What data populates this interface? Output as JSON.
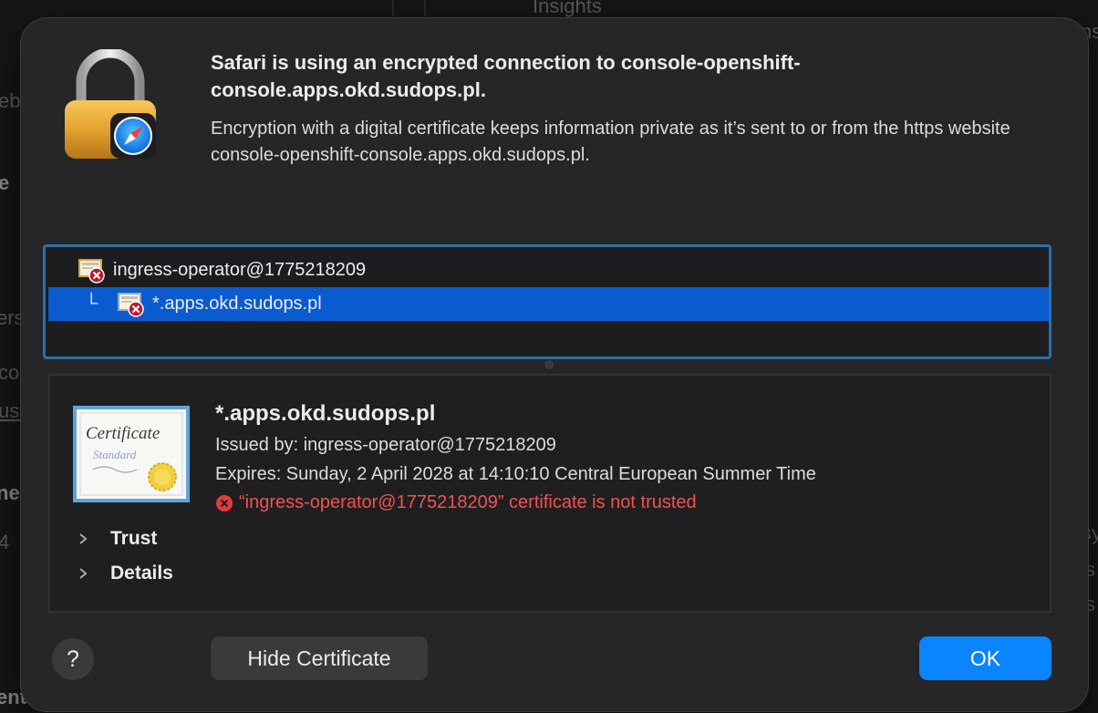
{
  "background": {
    "fragments": [
      "Insights",
      "eb",
      "e",
      "ers",
      "co",
      "ust",
      "ne",
      "4",
      "ins",
      "sy",
      "s",
      "s",
      "entory"
    ]
  },
  "dialog": {
    "heading": "Safari is using an encrypted connection to console-openshift-console.apps.okd.sudops.pl.",
    "description": "Encryption with a digital certificate keeps information private as it’s sent to or from the https website console-openshift-console.apps.okd.sudops.pl."
  },
  "certificate_tree": {
    "items": [
      {
        "label": "ingress-operator@1775218209",
        "level": 0,
        "selected": false,
        "status": "untrusted"
      },
      {
        "label": "*.apps.okd.sudops.pl",
        "level": 1,
        "selected": true,
        "status": "untrusted"
      }
    ]
  },
  "certificate_detail": {
    "name": "*.apps.okd.sudops.pl",
    "issued_by": "Issued by: ingress-operator@1775218209",
    "expires": "Expires: Sunday, 2 April 2028 at 14:10:10 Central European Summer Time",
    "warning": "“ingress-operator@1775218209” certificate is not trusted",
    "thumbnail_title": "Certificate",
    "thumbnail_subtitle": "Standard",
    "sections": [
      {
        "label": "Trust",
        "expanded": false
      },
      {
        "label": "Details",
        "expanded": false
      }
    ]
  },
  "buttons": {
    "help": "?",
    "hide_certificate": "Hide Certificate",
    "ok": "OK"
  },
  "colors": {
    "selection": "#0a5bcf",
    "accent": "#0a84ff",
    "focus_ring": "#2d6fa8",
    "error": "#ef5350"
  }
}
